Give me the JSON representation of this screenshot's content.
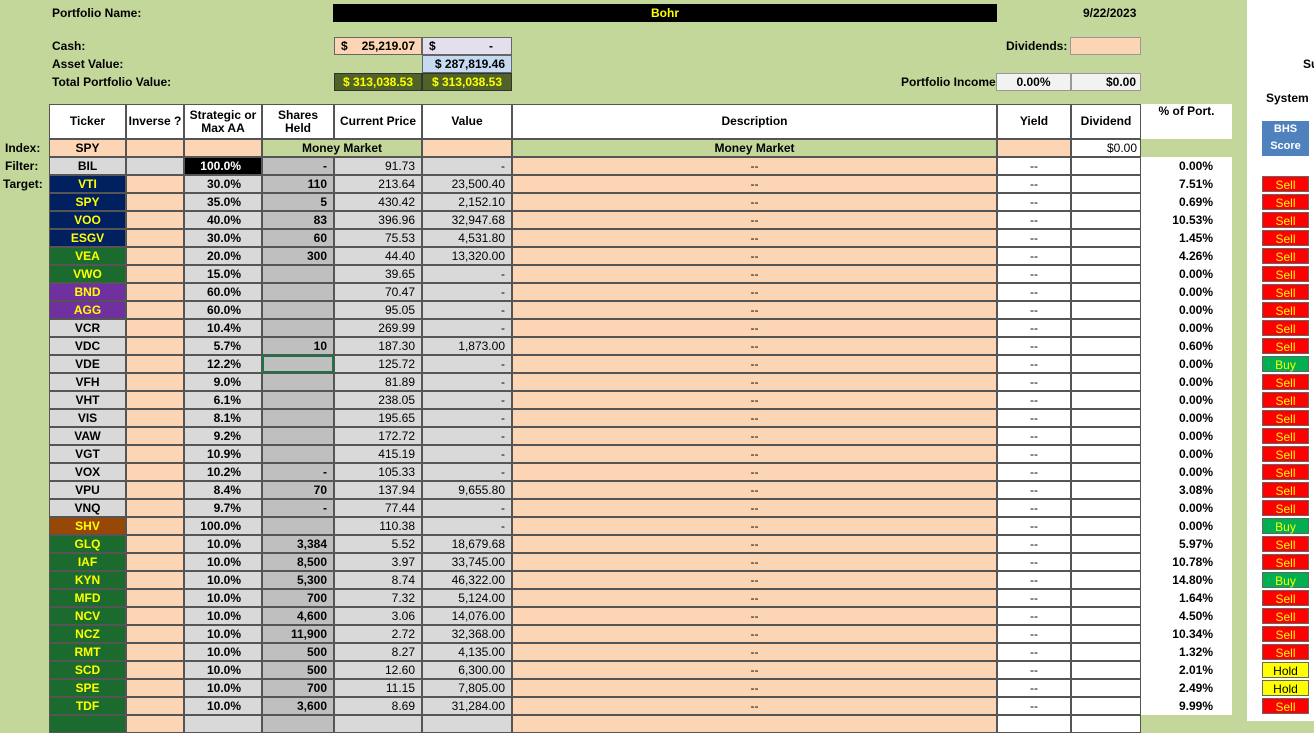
{
  "header": {
    "portfolio_name_label": "Portfolio Name:",
    "portfolio_name": "Bohr",
    "date": "9/22/2023",
    "cash_label": "Cash:",
    "cash_sym": "$",
    "cash_value": "25,219.07",
    "cash2_sym": "$",
    "cash2_value": "-",
    "asset_label": "Asset Value:",
    "asset_value": "$ 287,819.46",
    "total_label": "Total Portfolio Value:",
    "total_value_1": "$ 313,038.53",
    "total_value_2": "$ 313,038.53",
    "dividends_label": "Dividends:",
    "income_label": "Portfolio Income",
    "income_pct": "0.00%",
    "income_amt": "$0.00"
  },
  "right_panel": {
    "su_text": "Su",
    "system_label": "System",
    "bhs_line1": "BHS",
    "bhs_line2": "Score"
  },
  "columns": {
    "ticker": "Ticker",
    "inverse": "Inverse ?",
    "strategic_1": "Strategic or",
    "strategic_2": "Max AA",
    "shares_1": "Shares",
    "shares_2": "Held",
    "price": "Current Price",
    "value": "Value",
    "description": "Description",
    "yield": "Yield",
    "dividend": "Dividend",
    "pct_port": "% of Port."
  },
  "index_row": {
    "label": "Index:",
    "ticker": "SPY",
    "money_market_1": "Money Market",
    "money_market_2": "Money Market",
    "dividend": "$0.00"
  },
  "row_labels": {
    "filter": "Filter:",
    "target": "Target:"
  },
  "colors": {
    "background": "#c4d79b",
    "peach": "#fcd5b4",
    "navy": "#002060",
    "green": "#1b6b2f",
    "purple": "#7030a0",
    "brown": "#974706",
    "sell": "#ff0000",
    "buy": "#00b050",
    "hold": "#ffff00"
  },
  "rows": [
    {
      "ticker": "BIL",
      "tcolor": "gray",
      "aa": "100.0%",
      "aa_black": true,
      "shares": "-",
      "price": "91.73",
      "value": "-",
      "desc": "--",
      "yield": "--",
      "pct": "0.00%",
      "signal": ""
    },
    {
      "ticker": "VTI",
      "tcolor": "navy",
      "aa": "30.0%",
      "shares": "110",
      "price": "213.64",
      "value": "23,500.40",
      "desc": "--",
      "yield": "--",
      "pct": "7.51%",
      "signal": "Sell"
    },
    {
      "ticker": "SPY",
      "tcolor": "navy",
      "aa": "35.0%",
      "shares": "5",
      "price": "430.42",
      "value": "2,152.10",
      "desc": "--",
      "yield": "--",
      "pct": "0.69%",
      "signal": "Sell"
    },
    {
      "ticker": "VOO",
      "tcolor": "navy",
      "aa": "40.0%",
      "shares": "83",
      "price": "396.96",
      "value": "32,947.68",
      "desc": "--",
      "yield": "--",
      "pct": "10.53%",
      "signal": "Sell"
    },
    {
      "ticker": "ESGV",
      "tcolor": "navy",
      "aa": "30.0%",
      "shares": "60",
      "price": "75.53",
      "value": "4,531.80",
      "desc": "--",
      "yield": "--",
      "pct": "1.45%",
      "signal": "Sell"
    },
    {
      "ticker": "VEA",
      "tcolor": "green",
      "aa": "20.0%",
      "shares": "300",
      "price": "44.40",
      "value": "13,320.00",
      "desc": "--",
      "yield": "--",
      "pct": "4.26%",
      "signal": "Sell"
    },
    {
      "ticker": "VWO",
      "tcolor": "green",
      "aa": "15.0%",
      "shares": "",
      "price": "39.65",
      "value": "-",
      "desc": "--",
      "yield": "--",
      "pct": "0.00%",
      "signal": "Sell"
    },
    {
      "ticker": "BND",
      "tcolor": "purple",
      "aa": "60.0%",
      "shares": "",
      "price": "70.47",
      "value": "-",
      "desc": "--",
      "yield": "--",
      "pct": "0.00%",
      "signal": "Sell"
    },
    {
      "ticker": "AGG",
      "tcolor": "purple",
      "aa": "60.0%",
      "shares": "",
      "price": "95.05",
      "value": "-",
      "desc": "--",
      "yield": "--",
      "pct": "0.00%",
      "signal": "Sell"
    },
    {
      "ticker": "VCR",
      "tcolor": "gray",
      "aa": "10.4%",
      "shares": "",
      "price": "269.99",
      "value": "-",
      "desc": "--",
      "yield": "--",
      "pct": "0.00%",
      "signal": "Sell"
    },
    {
      "ticker": "VDC",
      "tcolor": "gray",
      "aa": "5.7%",
      "shares": "10",
      "price": "187.30",
      "value": "1,873.00",
      "desc": "--",
      "yield": "--",
      "pct": "0.60%",
      "signal": "Sell"
    },
    {
      "ticker": "VDE",
      "tcolor": "gray",
      "aa": "12.2%",
      "shares": "",
      "price": "125.72",
      "value": "-",
      "desc": "--",
      "yield": "--",
      "pct": "0.00%",
      "signal": "Buy",
      "selected": true
    },
    {
      "ticker": "VFH",
      "tcolor": "gray",
      "aa": "9.0%",
      "shares": "",
      "price": "81.89",
      "value": "-",
      "desc": "--",
      "yield": "--",
      "pct": "0.00%",
      "signal": "Sell"
    },
    {
      "ticker": "VHT",
      "tcolor": "gray",
      "aa": "6.1%",
      "shares": "",
      "price": "238.05",
      "value": "-",
      "desc": "--",
      "yield": "--",
      "pct": "0.00%",
      "signal": "Sell"
    },
    {
      "ticker": "VIS",
      "tcolor": "gray",
      "aa": "8.1%",
      "shares": "",
      "price": "195.65",
      "value": "-",
      "desc": "--",
      "yield": "--",
      "pct": "0.00%",
      "signal": "Sell"
    },
    {
      "ticker": "VAW",
      "tcolor": "gray",
      "aa": "9.2%",
      "shares": "",
      "price": "172.72",
      "value": "-",
      "desc": "--",
      "yield": "--",
      "pct": "0.00%",
      "signal": "Sell"
    },
    {
      "ticker": "VGT",
      "tcolor": "gray",
      "aa": "10.9%",
      "shares": "",
      "price": "415.19",
      "value": "-",
      "desc": "--",
      "yield": "--",
      "pct": "0.00%",
      "signal": "Sell"
    },
    {
      "ticker": "VOX",
      "tcolor": "gray",
      "aa": "10.2%",
      "shares": "-",
      "price": "105.33",
      "value": "-",
      "desc": "--",
      "yield": "--",
      "pct": "0.00%",
      "signal": "Sell"
    },
    {
      "ticker": "VPU",
      "tcolor": "gray",
      "aa": "8.4%",
      "shares": "70",
      "price": "137.94",
      "value": "9,655.80",
      "desc": "--",
      "yield": "--",
      "pct": "3.08%",
      "signal": "Sell"
    },
    {
      "ticker": "VNQ",
      "tcolor": "gray",
      "aa": "9.7%",
      "shares": "-",
      "price": "77.44",
      "value": "-",
      "desc": "--",
      "yield": "--",
      "pct": "0.00%",
      "signal": "Sell"
    },
    {
      "ticker": "SHV",
      "tcolor": "brown",
      "aa": "100.0%",
      "shares": "",
      "price": "110.38",
      "value": "-",
      "desc": "--",
      "yield": "--",
      "pct": "0.00%",
      "signal": "Buy"
    },
    {
      "ticker": "GLQ",
      "tcolor": "green",
      "aa": "10.0%",
      "shares": "3,384",
      "price": "5.52",
      "value": "18,679.68",
      "desc": "--",
      "yield": "--",
      "pct": "5.97%",
      "signal": "Sell"
    },
    {
      "ticker": "IAF",
      "tcolor": "green",
      "aa": "10.0%",
      "shares": "8,500",
      "price": "3.97",
      "value": "33,745.00",
      "desc": "--",
      "yield": "--",
      "pct": "10.78%",
      "signal": "Sell"
    },
    {
      "ticker": "KYN",
      "tcolor": "green",
      "aa": "10.0%",
      "shares": "5,300",
      "price": "8.74",
      "value": "46,322.00",
      "desc": "--",
      "yield": "--",
      "pct": "14.80%",
      "signal": "Buy"
    },
    {
      "ticker": "MFD",
      "tcolor": "green",
      "aa": "10.0%",
      "shares": "700",
      "price": "7.32",
      "value": "5,124.00",
      "desc": "--",
      "yield": "--",
      "pct": "1.64%",
      "signal": "Sell"
    },
    {
      "ticker": "NCV",
      "tcolor": "green",
      "aa": "10.0%",
      "shares": "4,600",
      "price": "3.06",
      "value": "14,076.00",
      "desc": "--",
      "yield": "--",
      "pct": "4.50%",
      "signal": "Sell"
    },
    {
      "ticker": "NCZ",
      "tcolor": "green",
      "aa": "10.0%",
      "shares": "11,900",
      "price": "2.72",
      "value": "32,368.00",
      "desc": "--",
      "yield": "--",
      "pct": "10.34%",
      "signal": "Sell"
    },
    {
      "ticker": "RMT",
      "tcolor": "green",
      "aa": "10.0%",
      "shares": "500",
      "price": "8.27",
      "value": "4,135.00",
      "desc": "--",
      "yield": "--",
      "pct": "1.32%",
      "signal": "Sell"
    },
    {
      "ticker": "SCD",
      "tcolor": "green",
      "aa": "10.0%",
      "shares": "500",
      "price": "12.60",
      "value": "6,300.00",
      "desc": "--",
      "yield": "--",
      "pct": "2.01%",
      "signal": "Hold"
    },
    {
      "ticker": "SPE",
      "tcolor": "green",
      "aa": "10.0%",
      "shares": "700",
      "price": "11.15",
      "value": "7,805.00",
      "desc": "--",
      "yield": "--",
      "pct": "2.49%",
      "signal": "Hold"
    },
    {
      "ticker": "TDF",
      "tcolor": "green",
      "aa": "10.0%",
      "shares": "3,600",
      "price": "8.69",
      "value": "31,284.00",
      "desc": "--",
      "yield": "--",
      "pct": "9.99%",
      "signal": "Sell"
    }
  ]
}
